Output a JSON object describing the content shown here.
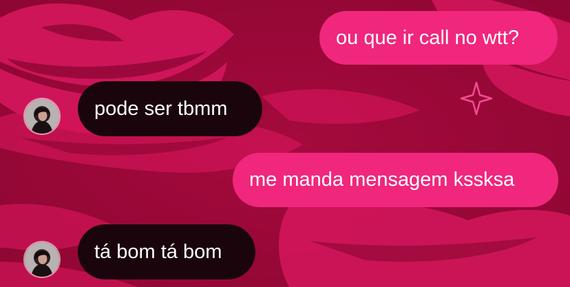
{
  "theme": {
    "background": "#a3083a",
    "sent_bubble": "#f0277d",
    "received_bubble": "#1a050c",
    "text": "#ffffff"
  },
  "messages": [
    {
      "direction": "sent",
      "text": "ou que ir call no wtt?"
    },
    {
      "direction": "received",
      "text": "pode ser tbmm",
      "avatar": "contact-avatar"
    },
    {
      "direction": "sent",
      "text": "me manda mensagem kssksa"
    },
    {
      "direction": "received",
      "text": "tá bom tá bom",
      "avatar": "contact-avatar"
    }
  ]
}
